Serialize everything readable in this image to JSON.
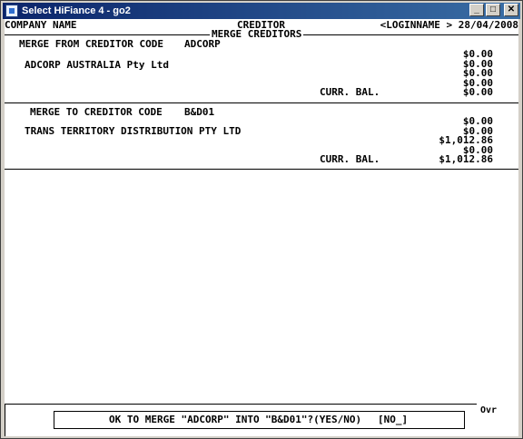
{
  "window": {
    "title": "Select HiFiance 4 - go2",
    "controls": {
      "minimize": "_",
      "maximize": "□",
      "close": "✕"
    }
  },
  "header": {
    "company": "COMPANY NAME",
    "module": "CREDITOR",
    "login_date": "<LOGINNAME > 28/04/2008",
    "section_title": "MERGE CREDITORS"
  },
  "merge_from": {
    "label": "MERGE FROM CREDITOR CODE",
    "code": "ADCORP",
    "name": "ADCORP AUSTRALIA Pty Ltd",
    "amounts": [
      "$0.00",
      "$0.00",
      "$0.00",
      "$0.00"
    ],
    "curr_bal_label": "CURR. BAL.",
    "curr_bal": "$0.00"
  },
  "merge_to": {
    "label": "MERGE TO CREDITOR CODE",
    "code": "B&D01",
    "name": "TRANS TERRITORY DISTRIBUTION PTY LTD",
    "amounts": [
      "$0.00",
      "$0.00",
      "$1,012.86",
      "$0.00"
    ],
    "curr_bal_label": "CURR. BAL.",
    "curr_bal": "$1,012.86"
  },
  "status": {
    "mode": "Ovr",
    "prompt": "OK TO MERGE \"ADCORP\" INTO \"B&D01\"?(YES/NO)",
    "answer": "[NO_]"
  }
}
